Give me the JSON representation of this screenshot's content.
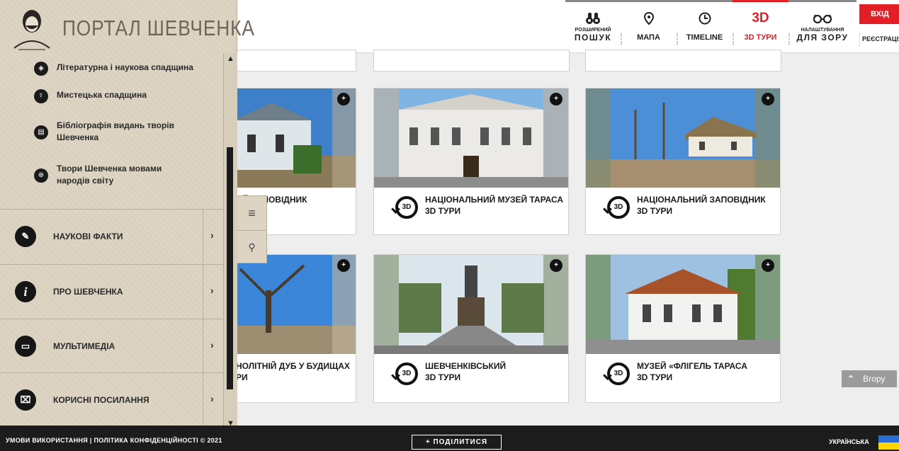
{
  "logo": {
    "text": "ПОРТАЛ ШЕВЧЕНКА"
  },
  "topnav": {
    "search": {
      "line1": "РОЗШИРЕНИЙ",
      "line2": "ПОШУК",
      "icon": "binoculars-icon"
    },
    "map": {
      "label": "МАПА",
      "icon": "map-pin-icon"
    },
    "timeline": {
      "label": "TIMELINE",
      "icon": "clock-icon"
    },
    "tours": {
      "icon_text": "3D",
      "label": "3D ТУРИ"
    },
    "vision": {
      "line1": "НАЛАШТУВАННЯ",
      "line2": "ДЛЯ ЗОРУ",
      "icon": "glasses-icon"
    },
    "login": "ВХІД",
    "register": "РЕЄСТРАЦІЯ",
    "accent": "#e21e26"
  },
  "sidebar": {
    "subitems": [
      {
        "label": "Літературна і наукова спадщина",
        "icon": "graduation-cap-icon"
      },
      {
        "label": "Мистецька спадщина",
        "icon": "art-icon"
      },
      {
        "label": "Бібліографія видань творів Шевченка",
        "icon": "book-icon"
      },
      {
        "label": "Твори Шевченка мовами народів світу",
        "icon": "globe-icon"
      }
    ],
    "main": [
      {
        "label": "НАУКОВІ ФАКТИ",
        "icon": "edit-icon",
        "arrow": "›"
      },
      {
        "label": "ПРО ШЕВЧЕНКА",
        "icon": "info-icon",
        "icon_text": "i",
        "arrow": "›"
      },
      {
        "label": "МУЛЬТИМЕДІА",
        "icon": "media-icon",
        "arrow": "›"
      },
      {
        "label": "КОРИСНІ ПОСИЛАННЯ",
        "icon": "link-screen-icon",
        "arrow": "›"
      }
    ],
    "scroll_up": "▲",
    "scroll_down": "▼",
    "menu_icon": "≡",
    "search_icon": "⚲"
  },
  "cards": [
    {
      "title": "ІЙ ЗАПОВІДНИК",
      "sub": ""
    },
    {
      "title": "НАЦІОНАЛЬНИЙ МУЗЕЙ ТАРАСА",
      "sub": "3D ТУРИ"
    },
    {
      "title": "НАЦІОНАЛЬНИЙ ЗАПОВІДНИК",
      "sub": "3D ТУРИ"
    },
    {
      "title": "НОЛІТНІЙ ДУБ У БУДИЩАХ",
      "sub": "РИ"
    },
    {
      "title": "ШЕВЧЕНКІВСЬКИЙ",
      "sub": "3D ТУРИ"
    },
    {
      "title": "МУЗЕЙ «ФЛІГЕЛЬ ТАРАСА",
      "sub": "3D ТУРИ"
    }
  ],
  "badge_text": "3D",
  "add_icon": "+",
  "up_button": "Вгору",
  "footer": {
    "links": "УМОВИ ВИКОРИСТАННЯ | ПОЛІТИКА КОНФІДЕНЦІЙНОСТІ © 2021",
    "share": "+ ПОДІЛИТИСЯ",
    "language": "УКРАЇНСЬКА"
  }
}
